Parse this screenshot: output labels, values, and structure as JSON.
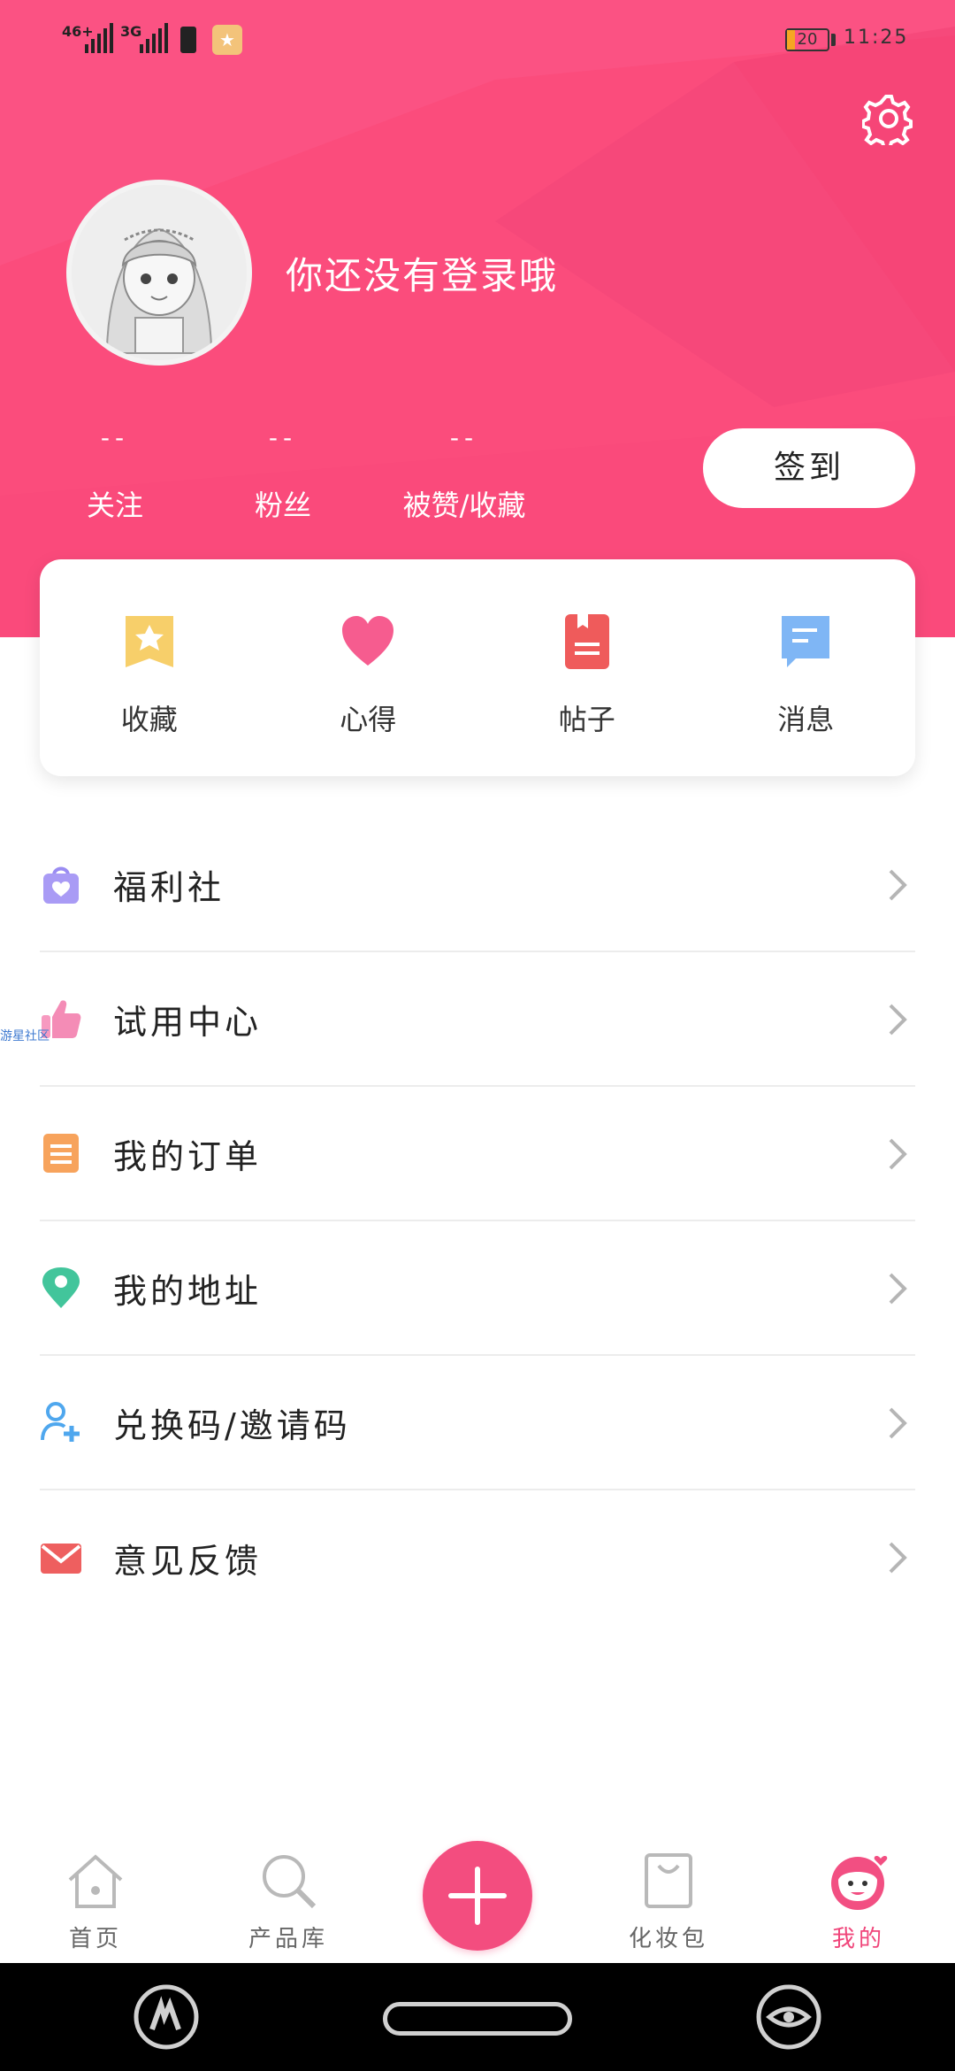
{
  "status_bar": {
    "network_1": "46+",
    "network_2": "3G",
    "battery_level": "20",
    "time": "11:25"
  },
  "header": {
    "login_prompt": "你还没有登录哦",
    "signin_button": "签到",
    "stats": [
      {
        "value": "--",
        "label": "关注"
      },
      {
        "value": "--",
        "label": "粉丝"
      },
      {
        "value": "--",
        "label": "被赞/收藏"
      }
    ]
  },
  "quick_actions": [
    {
      "label": "收藏",
      "icon": "favorites-star-icon"
    },
    {
      "label": "心得",
      "icon": "heart-icon"
    },
    {
      "label": "帖子",
      "icon": "post-bookmark-icon"
    },
    {
      "label": "消息",
      "icon": "message-bubble-icon"
    }
  ],
  "menu": [
    {
      "label": "福利社",
      "icon": "shopping-bag-heart-icon"
    },
    {
      "label": "试用中心",
      "icon": "thumbs-up-icon"
    },
    {
      "label": "我的订单",
      "icon": "order-list-icon"
    },
    {
      "label": "我的地址",
      "icon": "location-pin-icon"
    },
    {
      "label": "兑换码/邀请码",
      "icon": "add-user-icon"
    },
    {
      "label": "意见反馈",
      "icon": "mail-icon"
    }
  ],
  "watermark": "游星社区",
  "bottom_nav": [
    {
      "label": "首页",
      "icon": "home-icon",
      "active": false
    },
    {
      "label": "产品库",
      "icon": "search-icon",
      "active": false
    },
    {
      "label": "化妆包",
      "icon": "bag-icon",
      "active": false
    },
    {
      "label": "我的",
      "icon": "profile-face-icon",
      "active": true
    }
  ],
  "colors": {
    "brand_pink": "#fb4c7c",
    "active_tab": "#f0457a",
    "star_yellow": "#f7cf6a",
    "heart_pink": "#f65c8f",
    "post_red": "#ef5b5b",
    "message_blue": "#7fb6f5"
  }
}
